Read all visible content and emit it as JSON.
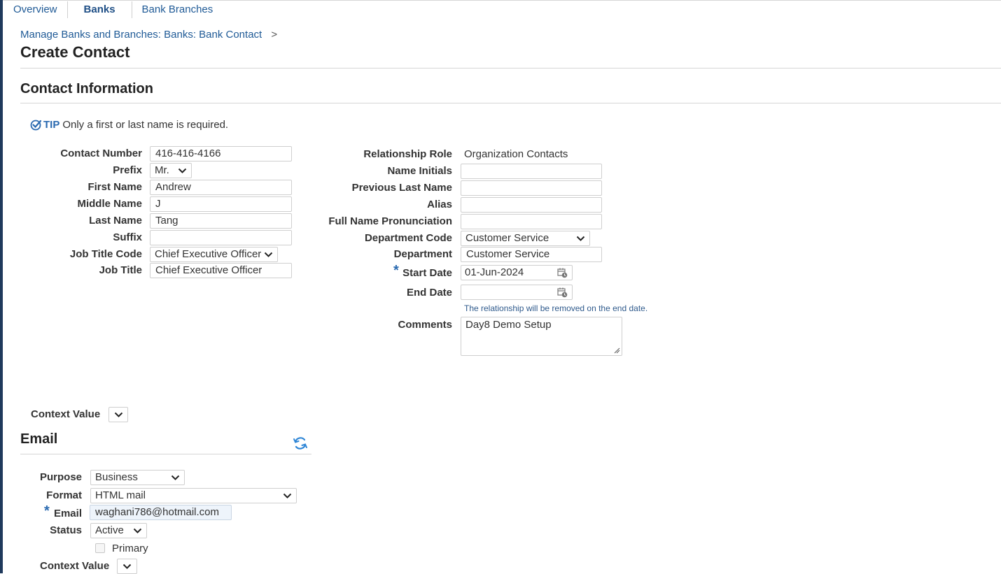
{
  "tabs": [
    "Overview",
    "Banks",
    "Bank Branches"
  ],
  "breadcrumb": {
    "path": "Manage Banks and Branches: Banks: Bank Contact",
    "sep": ">"
  },
  "page_title": "Create Contact",
  "contact_info": {
    "title": "Contact Information",
    "tip_label": "TIP",
    "tip_text": "Only a first or last name is required.",
    "left_fields": [
      {
        "label": "Contact Number",
        "value": "416-416-4166"
      },
      {
        "label": "Prefix",
        "value": "Mr."
      },
      {
        "label": "First Name",
        "value": "Andrew"
      },
      {
        "label": "Middle Name",
        "value": "J"
      },
      {
        "label": "Last Name",
        "value": "Tang"
      },
      {
        "label": "Suffix",
        "value": ""
      },
      {
        "label": "Job Title Code",
        "value": "Chief Executive Officer"
      },
      {
        "label": "Job Title",
        "value": "Chief Executive Officer"
      }
    ],
    "right_fields": [
      {
        "label": "Relationship Role",
        "value": "Organization Contacts"
      },
      {
        "label": "Name Initials",
        "value": ""
      },
      {
        "label": "Previous Last Name",
        "value": ""
      },
      {
        "label": "Alias",
        "value": ""
      },
      {
        "label": "Full Name Pronunciation",
        "value": ""
      },
      {
        "label": "Department Code",
        "value": "Customer Service"
      },
      {
        "label": "Department",
        "value": "Customer Service"
      },
      {
        "label": "Start Date",
        "value": "01-Jun-2024"
      },
      {
        "label": "End Date",
        "value": ""
      },
      {
        "label": "Comments",
        "value": "Day8 Demo Setup"
      }
    ],
    "end_date_note": "The relationship will be removed on the end date.",
    "context_value_label": "Context Value",
    "context_value": ""
  },
  "email": {
    "title": "Email",
    "purpose_label": "Purpose",
    "purpose": "Business",
    "format_label": "Format",
    "format": "HTML mail",
    "email_label": "Email",
    "email": "waghani786@hotmail.com",
    "status_label": "Status",
    "status": "Active",
    "primary_label": "Primary",
    "context_value_label": "Context Value",
    "context_value": ""
  },
  "required_marker": "*",
  "colors": {
    "link": "#1f5a96",
    "required": "#2a6ab0",
    "left_bar": "#1f3a5c"
  }
}
